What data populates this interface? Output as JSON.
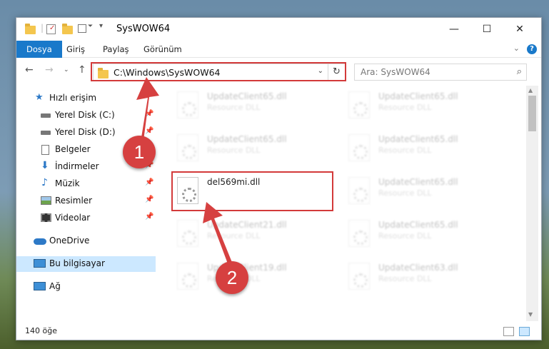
{
  "window": {
    "title": "SysWOW64"
  },
  "ribbon": {
    "tabs": [
      "Dosya",
      "Giriş",
      "Paylaş",
      "Görünüm"
    ]
  },
  "address": {
    "path": "C:\\Windows\\SysWOW64"
  },
  "search": {
    "placeholder": "Ara: SysWOW64"
  },
  "sidebar": {
    "items": [
      {
        "label": "Hızlı erişim"
      },
      {
        "label": "Yerel Disk (C:)"
      },
      {
        "label": "Yerel Disk (D:)"
      },
      {
        "label": "Belgeler"
      },
      {
        "label": "İndirmeler"
      },
      {
        "label": "Müzik"
      },
      {
        "label": "Resimler"
      },
      {
        "label": "Videolar"
      },
      {
        "label": "OneDrive"
      },
      {
        "label": "Bu bilgisayar"
      },
      {
        "label": "Ağ"
      }
    ]
  },
  "files": {
    "highlighted": {
      "name": "del569mi.dll"
    },
    "ghost": [
      {
        "name": "UpdateClient65.dll",
        "desc": "Resource DLL"
      },
      {
        "name": "UpdateClient65.dll",
        "desc": "Resource DLL"
      },
      {
        "name": "UpdateClient65.dll",
        "desc": "Resource DLL"
      },
      {
        "name": "UpdateClient65.dll",
        "desc": "Resource DLL"
      },
      {
        "name": "UpdateClient65.dll",
        "desc": "Resource DLL"
      },
      {
        "name": "UpdateClient21.dll",
        "desc": "Resource DLL"
      },
      {
        "name": "UpdateClient65.dll",
        "desc": "Resource DLL"
      },
      {
        "name": "UpdateClient19.dll",
        "desc": "Resource DLL"
      },
      {
        "name": "UpdateClient63.dll",
        "desc": "Resource DLL"
      }
    ]
  },
  "status": {
    "count": "140 öğe"
  },
  "callouts": {
    "one": "1",
    "two": "2"
  },
  "colors": {
    "accent": "#1979ca",
    "highlight": "#d33a3a",
    "selection": "#cce8ff"
  }
}
